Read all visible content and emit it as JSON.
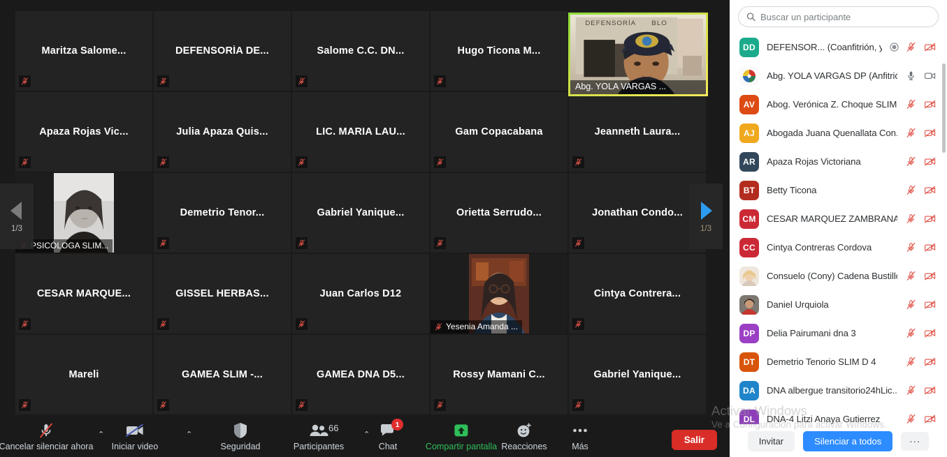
{
  "gallery": {
    "page_indicator": "1/3",
    "left_arrow_icon": "chevron-left-icon",
    "right_arrow_icon": "chevron-right-icon",
    "tiles": [
      {
        "name": "Maritza  Salome...",
        "video": false,
        "muted": true
      },
      {
        "name": "DEFENSORÍA  DE...",
        "video": false,
        "muted": true
      },
      {
        "name": "Salome C.C.  DN...",
        "video": false,
        "muted": true
      },
      {
        "name": "Hugo Ticona   M...",
        "video": false,
        "muted": true
      },
      {
        "name": "",
        "video": false,
        "muted": false,
        "hidden_name": true
      },
      {
        "name": "Apaza Rojas Vic...",
        "video": false,
        "muted": true
      },
      {
        "name": "Julia Apaza Quis...",
        "video": false,
        "muted": true
      },
      {
        "name": "LIC. MARIA LAU...",
        "video": false,
        "muted": true
      },
      {
        "name": "Gam Copacabana",
        "video": false,
        "muted": true
      },
      {
        "name": "Jeanneth Laura...",
        "video": false,
        "muted": true
      },
      {
        "name": "PSICÓLOGA SLIM...",
        "video": true,
        "muted": true,
        "thumb": "psicologa"
      },
      {
        "name": "Demetrio  Tenor...",
        "video": false,
        "muted": true
      },
      {
        "name": "Gabriel  Yanique...",
        "video": false,
        "muted": true
      },
      {
        "name": "Orietta Serrudo...",
        "video": false,
        "muted": true
      },
      {
        "name": "Jonathan  Condo...",
        "video": false,
        "muted": true
      },
      {
        "name": "CESAR  MARQUE...",
        "video": false,
        "muted": true
      },
      {
        "name": "GISSEL  HERBAS...",
        "video": false,
        "muted": true
      },
      {
        "name": "Juan Carlos D12",
        "video": false,
        "muted": true
      },
      {
        "name": "Yesenia Amanda ...",
        "video": true,
        "muted": true,
        "thumb": "yesenia"
      },
      {
        "name": "Cintya  Contrera...",
        "video": false,
        "muted": true
      },
      {
        "name": "Mareli",
        "video": false,
        "muted": true
      },
      {
        "name": "GAMEA SLIM -...",
        "video": false,
        "muted": true
      },
      {
        "name": "GAMEA DNA D5...",
        "video": false,
        "muted": true
      },
      {
        "name": "Rossy Mamani C...",
        "video": false,
        "muted": true
      },
      {
        "name": "Gabriel  Yanique...",
        "video": false,
        "muted": true
      }
    ],
    "active_speaker": {
      "label": "Abg. YOLA VARGAS ...",
      "border_color": "#c9e04a",
      "banner_text": "DEFENSORÍA DEL PUEBLO"
    }
  },
  "toolbar": {
    "items": [
      {
        "id": "mute",
        "label": "Cancelar silenciar ahora",
        "icon": "mic-off-icon",
        "caret": true
      },
      {
        "id": "video",
        "label": "Iniciar video",
        "icon": "video-off-icon",
        "caret": true
      },
      {
        "id": "security",
        "label": "Seguridad",
        "icon": "shield-icon",
        "caret": false
      },
      {
        "id": "participants",
        "label": "Participantes",
        "icon": "participants-icon",
        "caret": true,
        "count": "66"
      },
      {
        "id": "chat",
        "label": "Chat",
        "icon": "chat-icon",
        "caret": false,
        "badge": "1"
      },
      {
        "id": "share",
        "label": "Compartir pantalla",
        "icon": "share-screen-icon",
        "caret": true,
        "accent": "#2fbf5a"
      },
      {
        "id": "reactions",
        "label": "Reacciones",
        "icon": "reactions-icon",
        "caret": false
      },
      {
        "id": "more",
        "label": "Más",
        "icon": "ellipsis-icon",
        "caret": false
      }
    ],
    "leave_label": "Salir",
    "leave_color": "#d92d27"
  },
  "panel": {
    "search": {
      "placeholder": "Buscar un participante",
      "value": "",
      "icon": "search-icon"
    },
    "participants": [
      {
        "initials": "DD",
        "color": "#1bab8c",
        "name": "DEFENSOR... (Coanfitrión, yo)",
        "mic": "muted",
        "cam": "off",
        "recording": true,
        "photo": false
      },
      {
        "initials": "",
        "color": "#efefef",
        "name": "Abg. YOLA VARGAS DP (Anfitrión)",
        "mic": "on",
        "cam": "on",
        "photo": "logo"
      },
      {
        "initials": "AV",
        "color": "#dd4b13",
        "name": "Abog. Verónica Z. Choque SLIM...",
        "mic": "muted",
        "cam": "off",
        "photo": false
      },
      {
        "initials": "AJ",
        "color": "#f0a81e",
        "name": "Abogada Juana Quenallata Con...",
        "mic": "muted",
        "cam": "off",
        "photo": false
      },
      {
        "initials": "AR",
        "color": "#33475b",
        "name": "Apaza Rojas Victoriana",
        "mic": "muted",
        "cam": "off",
        "photo": false
      },
      {
        "initials": "BT",
        "color": "#b32d1f",
        "name": "Betty Ticona",
        "mic": "muted",
        "cam": "off",
        "photo": false
      },
      {
        "initials": "CM",
        "color": "#cc2936",
        "name": "CESAR MARQUEZ ZAMBRANA",
        "mic": "muted",
        "cam": "off",
        "photo": false
      },
      {
        "initials": "CC",
        "color": "#cc2936",
        "name": "Cintya Contreras Cordova",
        "mic": "muted",
        "cam": "off",
        "photo": false
      },
      {
        "initials": "",
        "color": "#d8c6b4",
        "name": "Consuelo (Cony) Cadena Bustillos",
        "mic": "muted",
        "cam": "off",
        "photo": "person1"
      },
      {
        "initials": "",
        "color": "#6a5a52",
        "name": "Daniel Urquiola",
        "mic": "muted",
        "cam": "off",
        "photo": "person2"
      },
      {
        "initials": "DP",
        "color": "#9b3fc4",
        "name": "Delia Pairumani dna 3",
        "mic": "muted",
        "cam": "off",
        "photo": false
      },
      {
        "initials": "DT",
        "color": "#d9540b",
        "name": "Demetrio  Tenorio SLIM D 4",
        "mic": "muted",
        "cam": "off",
        "photo": false
      },
      {
        "initials": "DA",
        "color": "#1f84c9",
        "name": "DNA albergue transitorio24hLic....",
        "mic": "muted",
        "cam": "off",
        "photo": false
      },
      {
        "initials": "DL",
        "color": "#8e3fb8",
        "name": "DNA-4 Litzi Anaya Gutierrez",
        "mic": "muted",
        "cam": "off",
        "photo": false
      }
    ],
    "footer": {
      "invite_label": "Invitar",
      "mute_all_label": "Silenciar a todos",
      "more_label": "···"
    }
  },
  "watermark": {
    "line1": "Activar Windows",
    "line2": "Ve a Configuración para activar Windows."
  }
}
